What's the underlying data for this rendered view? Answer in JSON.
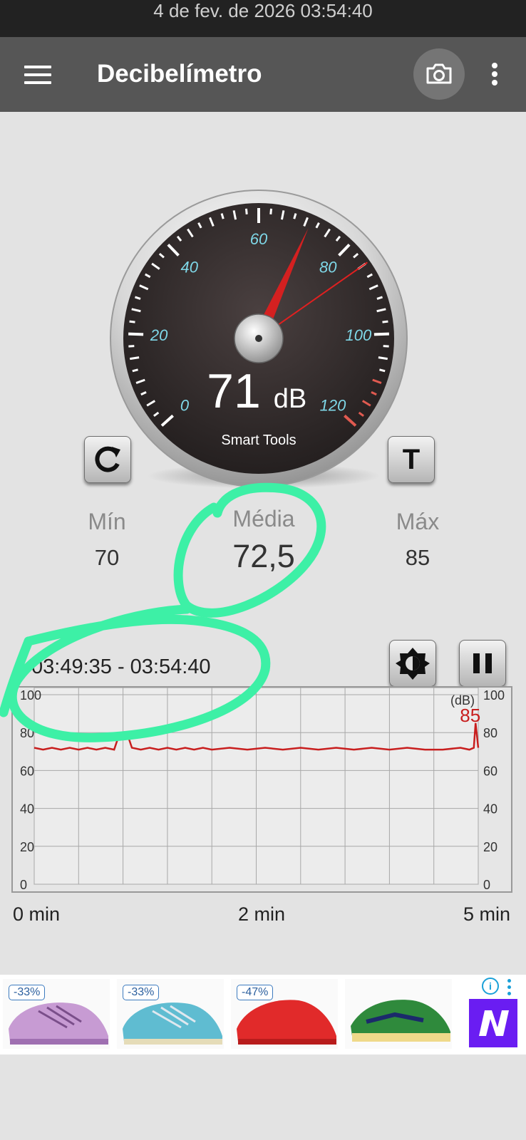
{
  "status_bar": {
    "datetime": "4 de fev. de 2026 03:54:40"
  },
  "app_bar": {
    "title": "Decibelímetro",
    "icons": [
      "menu-icon",
      "camera-icon",
      "more-vert-icon"
    ]
  },
  "gauge": {
    "value": 71,
    "value_text": "71",
    "unit": "dB",
    "brand": "Smart Tools",
    "scale_labels": [
      "0",
      "20",
      "40",
      "60",
      "80",
      "100",
      "120"
    ],
    "scale_min": 0,
    "scale_max": 120,
    "max_marker_value": 85,
    "label_color": "#7fd8e8",
    "danger_color": "#e05a50",
    "needle_color": "#d42020"
  },
  "buttons": {
    "reset_icon": "refresh-icon",
    "text_mode_label": "T"
  },
  "stats": {
    "min_label": "Mín",
    "min_value": "70",
    "avg_label": "Média",
    "avg_value": "72,5",
    "max_label": "Máx",
    "max_value": "85"
  },
  "graph_controls": {
    "brightness_icon": "brightness-icon",
    "pause_icon": "pause-icon"
  },
  "time_range": "03:49:35 - 03:54:40",
  "chart_data": {
    "type": "line",
    "title": "",
    "ylabel": "(dB)",
    "ylim": [
      0,
      100
    ],
    "yticks": [
      "0",
      "20",
      "40",
      "60",
      "80",
      "100"
    ],
    "xlim": [
      0,
      5
    ],
    "xtick_labels": [
      "0 min",
      "2 min",
      "5 min"
    ],
    "grid": true,
    "series": [
      {
        "color": "#c81e1e",
        "x": [
          0,
          0.1,
          0.2,
          0.3,
          0.4,
          0.5,
          0.6,
          0.7,
          0.8,
          0.9,
          0.95,
          1.0,
          1.05,
          1.1,
          1.2,
          1.3,
          1.4,
          1.5,
          1.6,
          1.7,
          1.8,
          1.9,
          2.0,
          2.2,
          2.4,
          2.6,
          2.8,
          3.0,
          3.2,
          3.4,
          3.6,
          3.8,
          4.0,
          4.2,
          4.4,
          4.6,
          4.8,
          4.9,
          4.95,
          4.97,
          5.0
        ],
        "y": [
          72,
          71,
          72,
          71,
          72,
          71,
          72,
          71,
          72,
          71,
          78,
          80,
          79,
          72,
          71,
          72,
          71,
          72,
          71,
          72,
          71,
          72,
          71,
          72,
          71,
          72,
          71,
          72,
          71,
          72,
          71,
          72,
          71,
          72,
          71,
          71,
          72,
          71,
          72,
          85,
          72
        ]
      }
    ],
    "annotation": {
      "text": "85",
      "x": 4.97,
      "y": 85
    }
  },
  "ad": {
    "discounts": [
      "-33%",
      "-33%",
      "-47%"
    ],
    "info_icon": "info-icon",
    "brand_logo": "N",
    "accent": "#1aa0d8"
  }
}
